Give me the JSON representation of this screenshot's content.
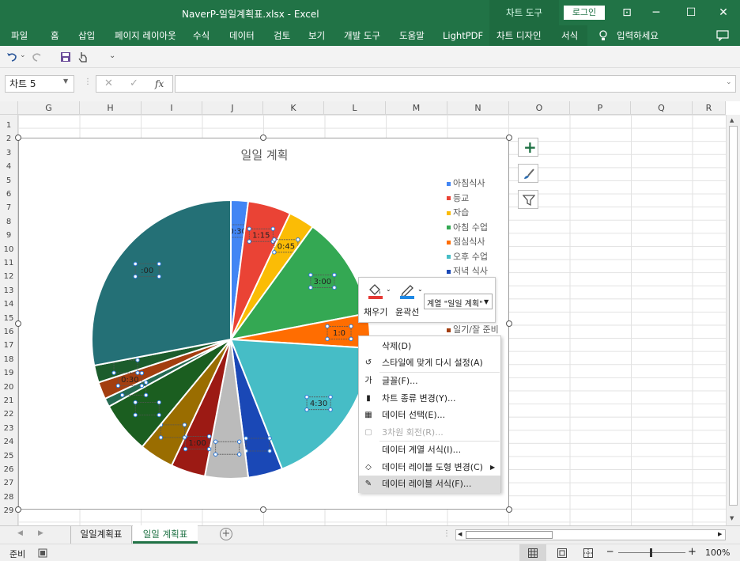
{
  "window": {
    "title": "NaverP-일일계획표.xlsx  -  Excel",
    "chart_tools": "차트 도구",
    "login": "로그인",
    "restore_icon": "⊡",
    "min_icon": "─",
    "max_icon": "☐",
    "close_icon": "✕"
  },
  "ribbon": {
    "tabs": [
      "파일",
      "홈",
      "삽입",
      "페이지 레이아웃",
      "수식",
      "데이터",
      "검토",
      "보기",
      "개발 도구",
      "도움말",
      "LightPDF"
    ],
    "ctx_tabs": [
      "차트 디자인",
      "서식"
    ],
    "tell_me": "입력하세요"
  },
  "formula": {
    "name_box": "차트 5",
    "cancel": "✕",
    "enter": "✓",
    "fx": "fx",
    "value": ""
  },
  "columns": [
    "G",
    "H",
    "I",
    "J",
    "K",
    "L",
    "M",
    "N",
    "O",
    "P",
    "Q",
    "R"
  ],
  "rows": [
    "1",
    "2",
    "3",
    "4",
    "5",
    "6",
    "7",
    "8",
    "9",
    "10",
    "11",
    "12",
    "13",
    "14",
    "15",
    "16",
    "17",
    "18",
    "19",
    "20",
    "21",
    "22",
    "23",
    "24",
    "25",
    "26",
    "27",
    "28",
    "29"
  ],
  "chart_data": {
    "type": "pie",
    "title": "일일 계획",
    "categories": [
      "아침식사",
      "등교",
      "자습",
      "아침 수업",
      "점심식사",
      "오후 수업",
      "저녁 식사",
      "",
      "",
      "",
      "",
      "",
      "일기/잘 준비",
      "",
      ""
    ],
    "values": [
      0.5,
      1.25,
      0.75,
      3.0,
      1.0,
      4.5,
      1.0,
      1.25,
      1.0,
      1.0,
      1.5,
      0.25,
      0.5,
      0.5,
      7.0
    ],
    "labels": [
      "0:30",
      "1:15",
      "0:45",
      "3:00",
      "1:0",
      "4:30",
      "",
      "",
      "1:00",
      "",
      "",
      "",
      "0:30",
      "",
      ":00"
    ],
    "colors": [
      "#4285f4",
      "#ea4335",
      "#fbbc05",
      "#34a853",
      "#ff6d01",
      "#46bdc6",
      "#1a48b6",
      "#bbbbbb",
      "#9c1a14",
      "#9a6d00",
      "#1b5e20",
      "#256a52",
      "#a33e10",
      "#1c5c2c",
      "#247076"
    ],
    "legend": {
      "position": "right",
      "visible_entries": [
        "아침식사",
        "등교",
        "자습",
        "아침 수업",
        "점심식사",
        "오후 수업",
        "저녁 식사",
        "일기/잘 준비"
      ]
    }
  },
  "chart_buttons": {
    "add": "+",
    "style": "✎",
    "filter": "⏷"
  },
  "mini_toolbar": {
    "fill": "채우기",
    "outline": "윤곽선",
    "series_select": "계열 \"일일 계획\""
  },
  "context_menu": {
    "items": [
      {
        "label": "삭제(D)",
        "icon": "",
        "enabled": true
      },
      {
        "label": "스타일에 맞게 다시 설정(A)",
        "icon": "↺",
        "enabled": true
      },
      {
        "label": "글꼴(F)...",
        "icon": "가",
        "enabled": true
      },
      {
        "label": "차트 종류 변경(Y)...",
        "icon": "▮",
        "enabled": true
      },
      {
        "label": "데이터 선택(E)...",
        "icon": "▦",
        "enabled": true
      },
      {
        "label": "3차원 회전(R)...",
        "icon": "▢",
        "enabled": false
      },
      {
        "label": "데이터 계열 서식(I)...",
        "icon": "",
        "enabled": true
      },
      {
        "label": "데이터 레이블 도형 변경(C)",
        "icon": "◇",
        "enabled": true,
        "submenu": true
      },
      {
        "label": "데이터 레이블 서식(F)...",
        "icon": "✎",
        "enabled": true,
        "highlighted": true
      }
    ]
  },
  "sheets": {
    "tabs": [
      "일일계획표",
      "일일 계획표"
    ],
    "active": 1,
    "add": "+"
  },
  "status": {
    "ready": "준비",
    "zoom": "100%",
    "minus": "─",
    "plus": "+"
  }
}
